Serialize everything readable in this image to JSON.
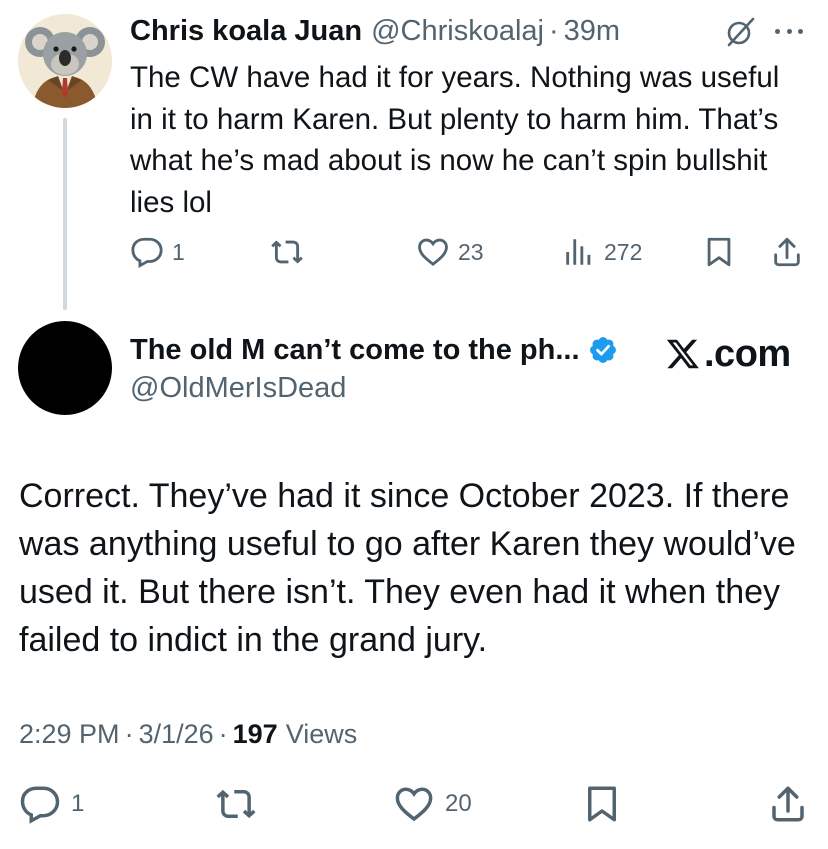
{
  "reply": {
    "display_name": "Chris koala Juan",
    "handle": "@Chriskoalaj",
    "separator": "·",
    "time_ago": "39m",
    "text": "The CW have had it for years. Nothing was useful in it to harm Karen. But plenty to harm him. That’s what he’s mad about is now he can’t spin bullshit lies lol",
    "stats": {
      "replies": "1",
      "reposts": "",
      "likes": "23",
      "views": "272"
    },
    "icons": {
      "grok": "grok-icon",
      "more": "more-icon",
      "reply": "reply-icon",
      "repost": "repost-icon",
      "like": "heart-icon",
      "views": "views-chart-icon",
      "bookmark": "bookmark-icon",
      "share": "share-icon"
    }
  },
  "main": {
    "display_name": "The old M can’t come to the ph...",
    "handle": "@OldMerIsDead",
    "verified": true,
    "brand": "X.com",
    "text": "Correct. They’ve had it since October 2023. If there was anything useful to go after Karen they would’ve used it. But there isn’t. They even had it when they failed to indict in the grand jury.",
    "time": "2:29 PM",
    "date": "3/1/26",
    "separator": "·",
    "views_count": "197",
    "views_label": "Views",
    "stats": {
      "replies": "1",
      "reposts": "",
      "likes": "20"
    }
  },
  "colors": {
    "text_primary": "#0f1419",
    "text_secondary": "#536471",
    "verified_blue": "#1d9bf0",
    "thread_line": "#cfd9de",
    "background": "#ffffff"
  }
}
